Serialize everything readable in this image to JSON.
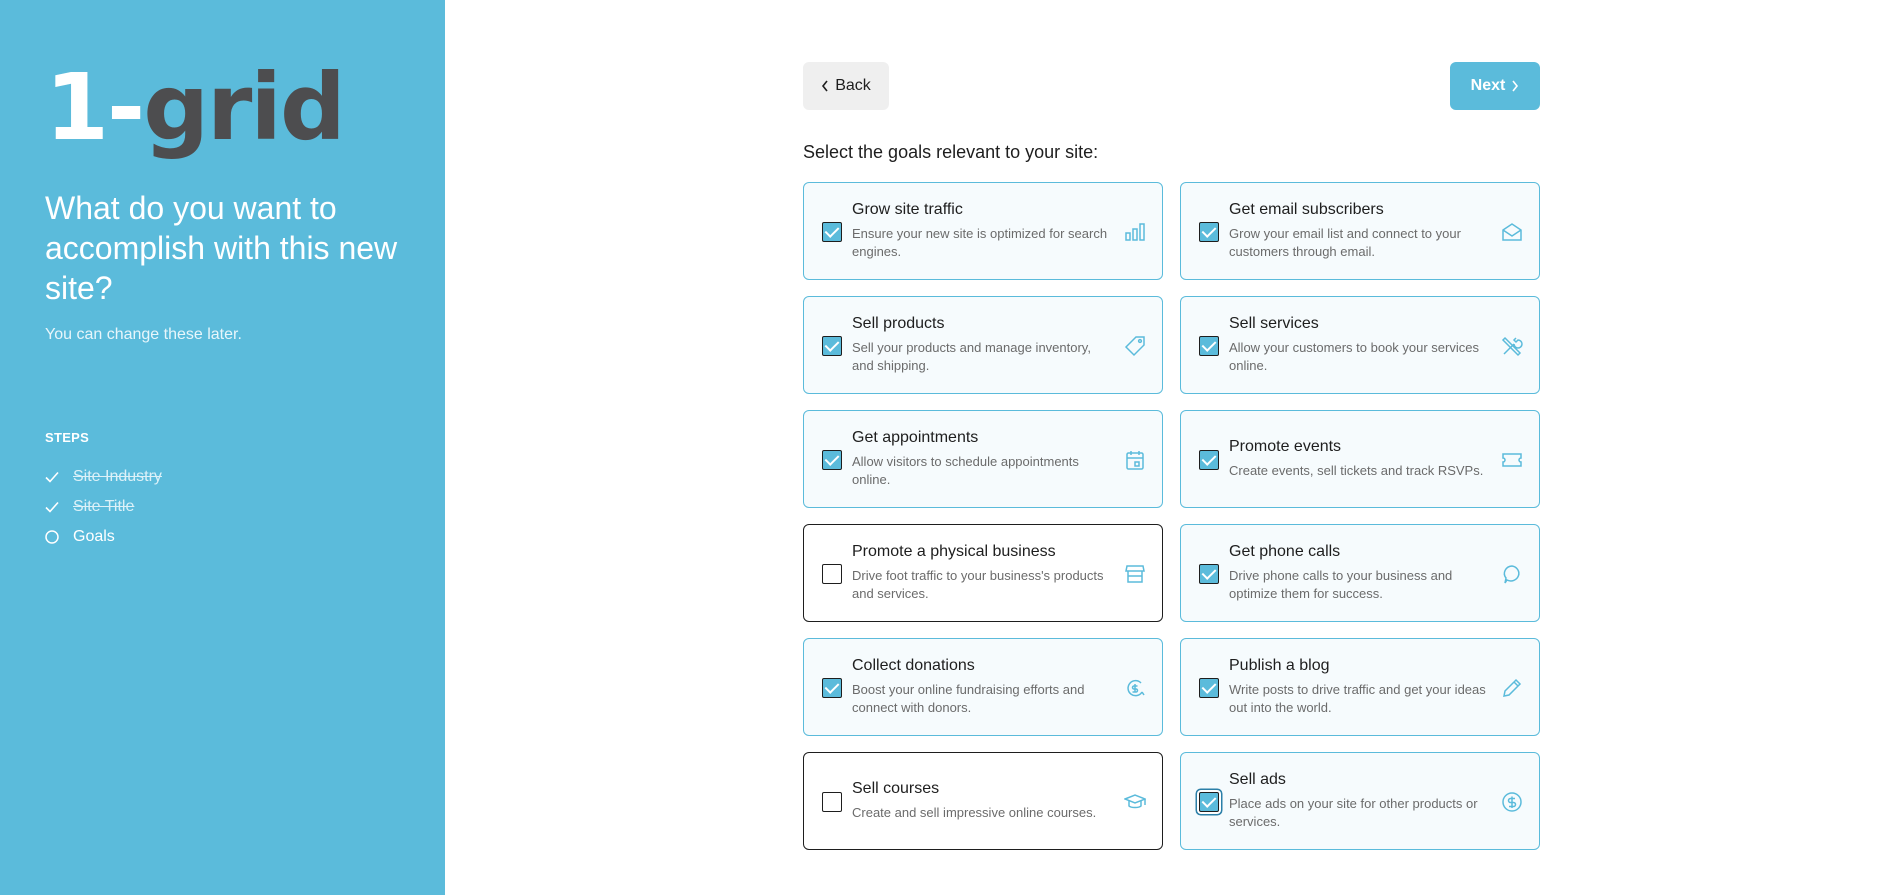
{
  "colors": {
    "accent": "#5bbbdb",
    "text": "#1e1e1e",
    "muted": "#6b6b6b"
  },
  "sidebar": {
    "logo_one": "1-",
    "logo_rest": "grid",
    "heading": "What do you want to accomplish with this new site?",
    "subheading": "You can change these later.",
    "steps_title": "STEPS",
    "steps": [
      {
        "label": "Site Industry",
        "state": "done"
      },
      {
        "label": "Site Title",
        "state": "done"
      },
      {
        "label": "Goals",
        "state": "current"
      }
    ]
  },
  "nav": {
    "back_label": "Back",
    "next_label": "Next"
  },
  "prompt": "Select the goals relevant to your site:",
  "goals": [
    {
      "title": "Grow site traffic",
      "desc": "Ensure your new site is optimized for search engines.",
      "checked": true,
      "icon": "bar-chart-icon"
    },
    {
      "title": "Get email subscribers",
      "desc": "Grow your email list and connect to your customers through email.",
      "checked": true,
      "icon": "envelope-open-icon"
    },
    {
      "title": "Sell products",
      "desc": "Sell your products and manage inventory, and shipping.",
      "checked": true,
      "icon": "price-tag-icon"
    },
    {
      "title": "Sell services",
      "desc": "Allow your customers to book your services online.",
      "checked": true,
      "icon": "tools-icon"
    },
    {
      "title": "Get appointments",
      "desc": "Allow visitors to schedule appointments online.",
      "checked": true,
      "icon": "calendar-icon"
    },
    {
      "title": "Promote events",
      "desc": "Create events, sell tickets and track RSVPs.",
      "checked": true,
      "icon": "ticket-icon"
    },
    {
      "title": "Promote a physical business",
      "desc": "Drive foot traffic to your business's products and services.",
      "checked": false,
      "icon": "storefront-icon"
    },
    {
      "title": "Get phone calls",
      "desc": "Drive phone calls to your business and optimize them for success.",
      "checked": true,
      "icon": "speech-bubble-icon"
    },
    {
      "title": "Collect donations",
      "desc": "Boost your online fundraising efforts and connect with donors.",
      "checked": true,
      "icon": "donation-icon"
    },
    {
      "title": "Publish a blog",
      "desc": "Write posts to drive traffic and get your ideas out into the world.",
      "checked": true,
      "icon": "pencil-icon"
    },
    {
      "title": "Sell courses",
      "desc": "Create and sell impressive online courses.",
      "checked": false,
      "icon": "graduation-cap-icon"
    },
    {
      "title": "Sell ads",
      "desc": "Place ads on your site for other products or services.",
      "checked": true,
      "icon": "dollar-coin-icon"
    }
  ]
}
